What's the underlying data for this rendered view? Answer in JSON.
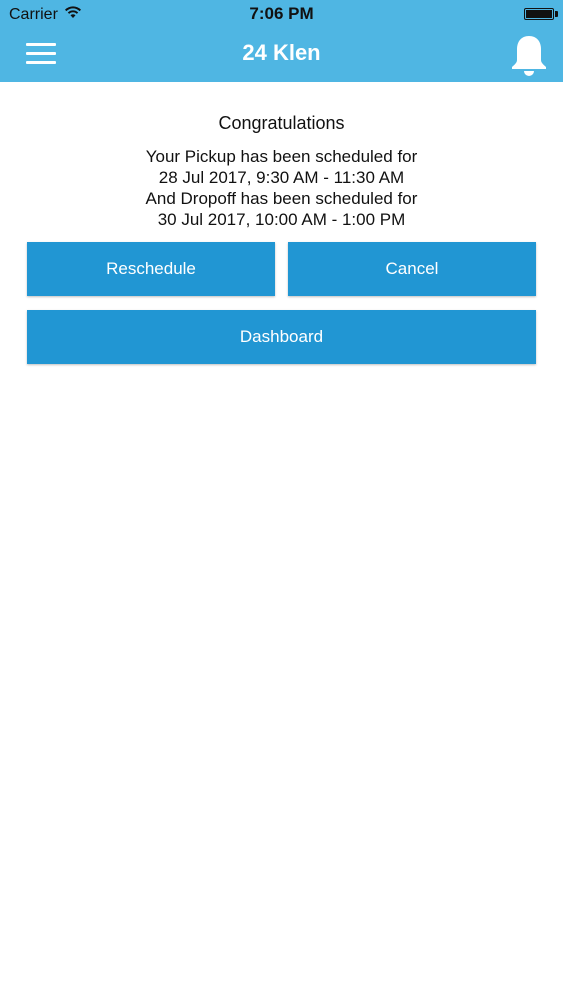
{
  "status_bar": {
    "carrier": "Carrier",
    "time": "7:06 PM"
  },
  "header": {
    "title": "24 Klen",
    "menu_icon": "hamburger-menu-icon",
    "notification_icon": "bell-icon",
    "background_color": "#4fb6e3"
  },
  "main": {
    "heading": "Congratulations",
    "pickup_line": "Your Pickup has been scheduled for",
    "pickup_time": "28 Jul 2017, 9:30 AM - 11:30 AM",
    "dropoff_line": "And Dropoff has been scheduled for",
    "dropoff_time": "30 Jul 2017, 10:00 AM - 1:00 PM"
  },
  "actions": {
    "reschedule_label": "Reschedule",
    "cancel_label": "Cancel",
    "dashboard_label": "Dashboard",
    "button_color": "#2196d3"
  }
}
